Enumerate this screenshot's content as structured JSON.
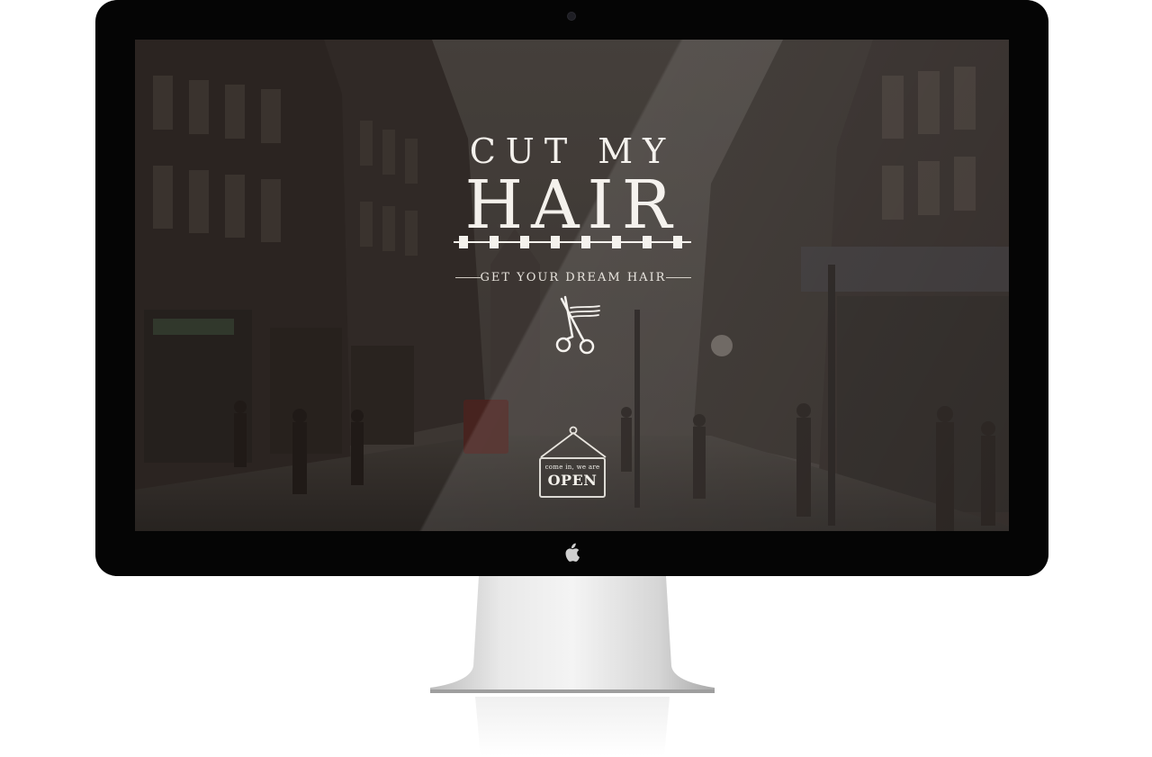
{
  "hero": {
    "title_line1": "CUT MY",
    "title_line2": "HAIR",
    "tagline": "GET YOUR DREAM HAIR"
  },
  "sign": {
    "small_text": "come in, we are",
    "big_text": "OPEN"
  },
  "icons": {
    "brand_mark": "scissors-icon",
    "bezel_logo": "apple-logo-icon"
  },
  "colors": {
    "text": "#f4f1ec",
    "bezel": "#050505",
    "screen_tint": "#3a3632"
  }
}
